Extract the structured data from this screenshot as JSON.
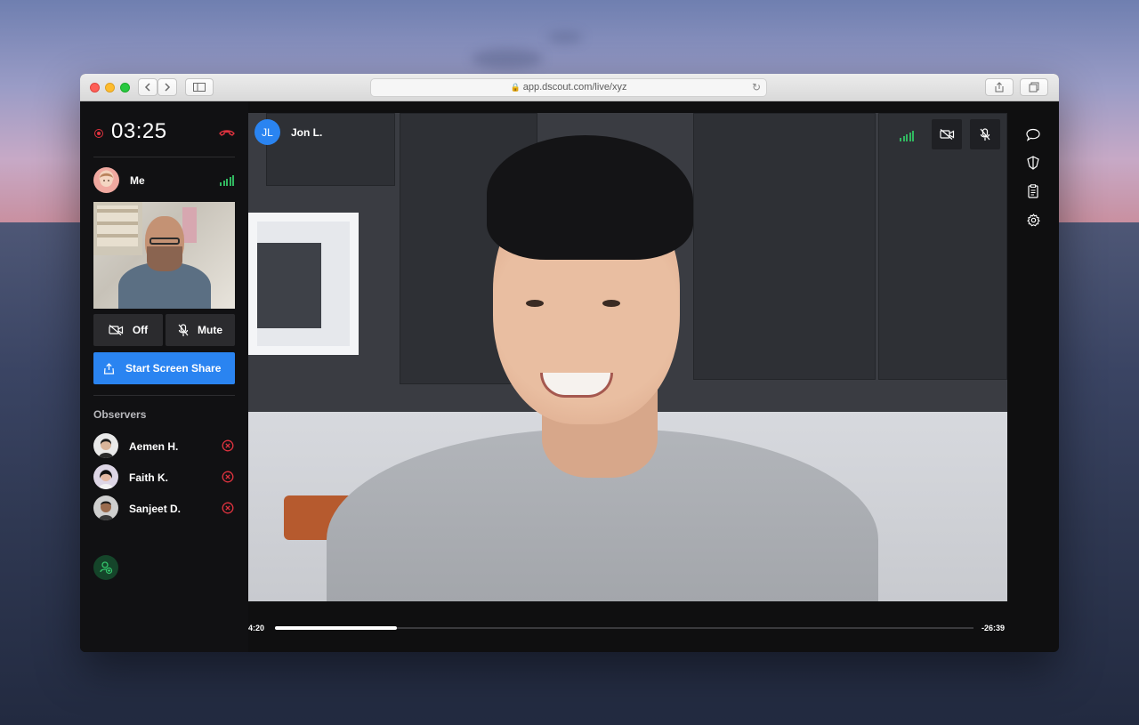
{
  "browser": {
    "url": "app.dscout.com/live/xyz"
  },
  "session": {
    "timer": "03:25",
    "recording": true
  },
  "self": {
    "name": "Me",
    "camera_label": "Off",
    "mic_label": "Mute",
    "share_label": "Start Screen Share"
  },
  "observers": {
    "title": "Observers",
    "list": [
      {
        "name": "Aemen H."
      },
      {
        "name": "Faith K."
      },
      {
        "name": "Sanjeet D."
      }
    ]
  },
  "participant": {
    "initials": "JL",
    "name": "Jon L."
  },
  "playback": {
    "elapsed": "4:20",
    "remaining": "-26:39",
    "progress": 0.175
  },
  "colors": {
    "accent": "#2a84f1",
    "danger": "#e0333f",
    "signal": "#31b760",
    "panel": "#111113"
  },
  "icons": {
    "hangup": "phone-hangup-icon",
    "camera_off": "camera-off-icon",
    "mic_off": "mic-off-icon",
    "share": "share-screen-icon",
    "remove": "remove-observer-icon",
    "add_observer": "add-observer-icon",
    "chat": "chat-icon",
    "highlight": "highlight-icon",
    "notes": "notes-icon",
    "settings": "settings-icon"
  }
}
